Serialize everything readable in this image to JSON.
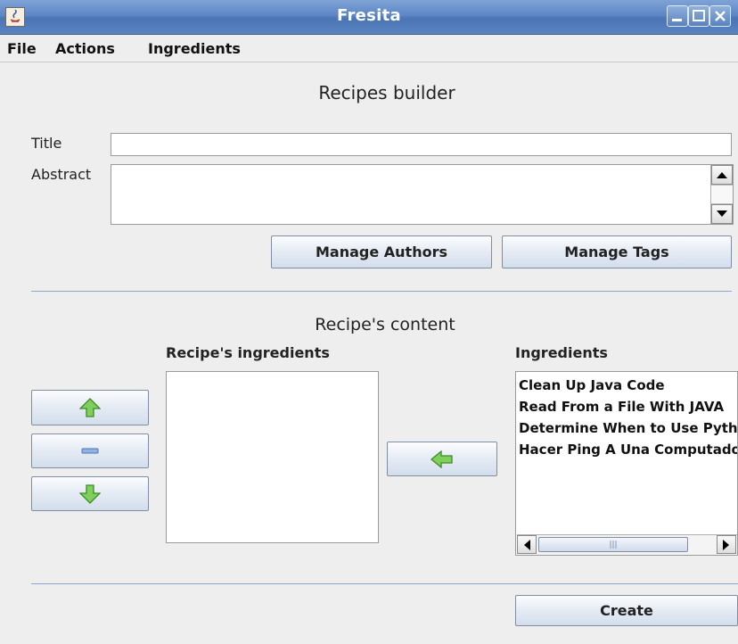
{
  "window": {
    "title": "Fresita"
  },
  "menu": {
    "items": [
      "File",
      "Actions",
      "Ingredients"
    ]
  },
  "form": {
    "heading": "Recipes builder",
    "title_label": "Title",
    "title_value": "",
    "abstract_label": "Abstract",
    "abstract_value": "",
    "manage_authors": "Manage Authors",
    "manage_tags": "Manage Tags"
  },
  "content": {
    "heading": "Recipe's content",
    "recipe_ingredients_label": "Recipe's ingredients",
    "ingredients_label": "Ingredients",
    "ingredients": [
      "Clean Up Java Code",
      "Read From a File With JAVA",
      "Determine When to Use Python",
      "Hacer Ping A Una Computadora"
    ],
    "create_label": "Create"
  },
  "icons": {
    "up": "arrow-up-icon",
    "remove": "minus-icon",
    "down": "arrow-down-icon",
    "add": "arrow-left-icon"
  },
  "colors": {
    "titlebar": "#5d86c4",
    "arrow_green": "#6cc04a",
    "separator": "#8da6cf"
  }
}
